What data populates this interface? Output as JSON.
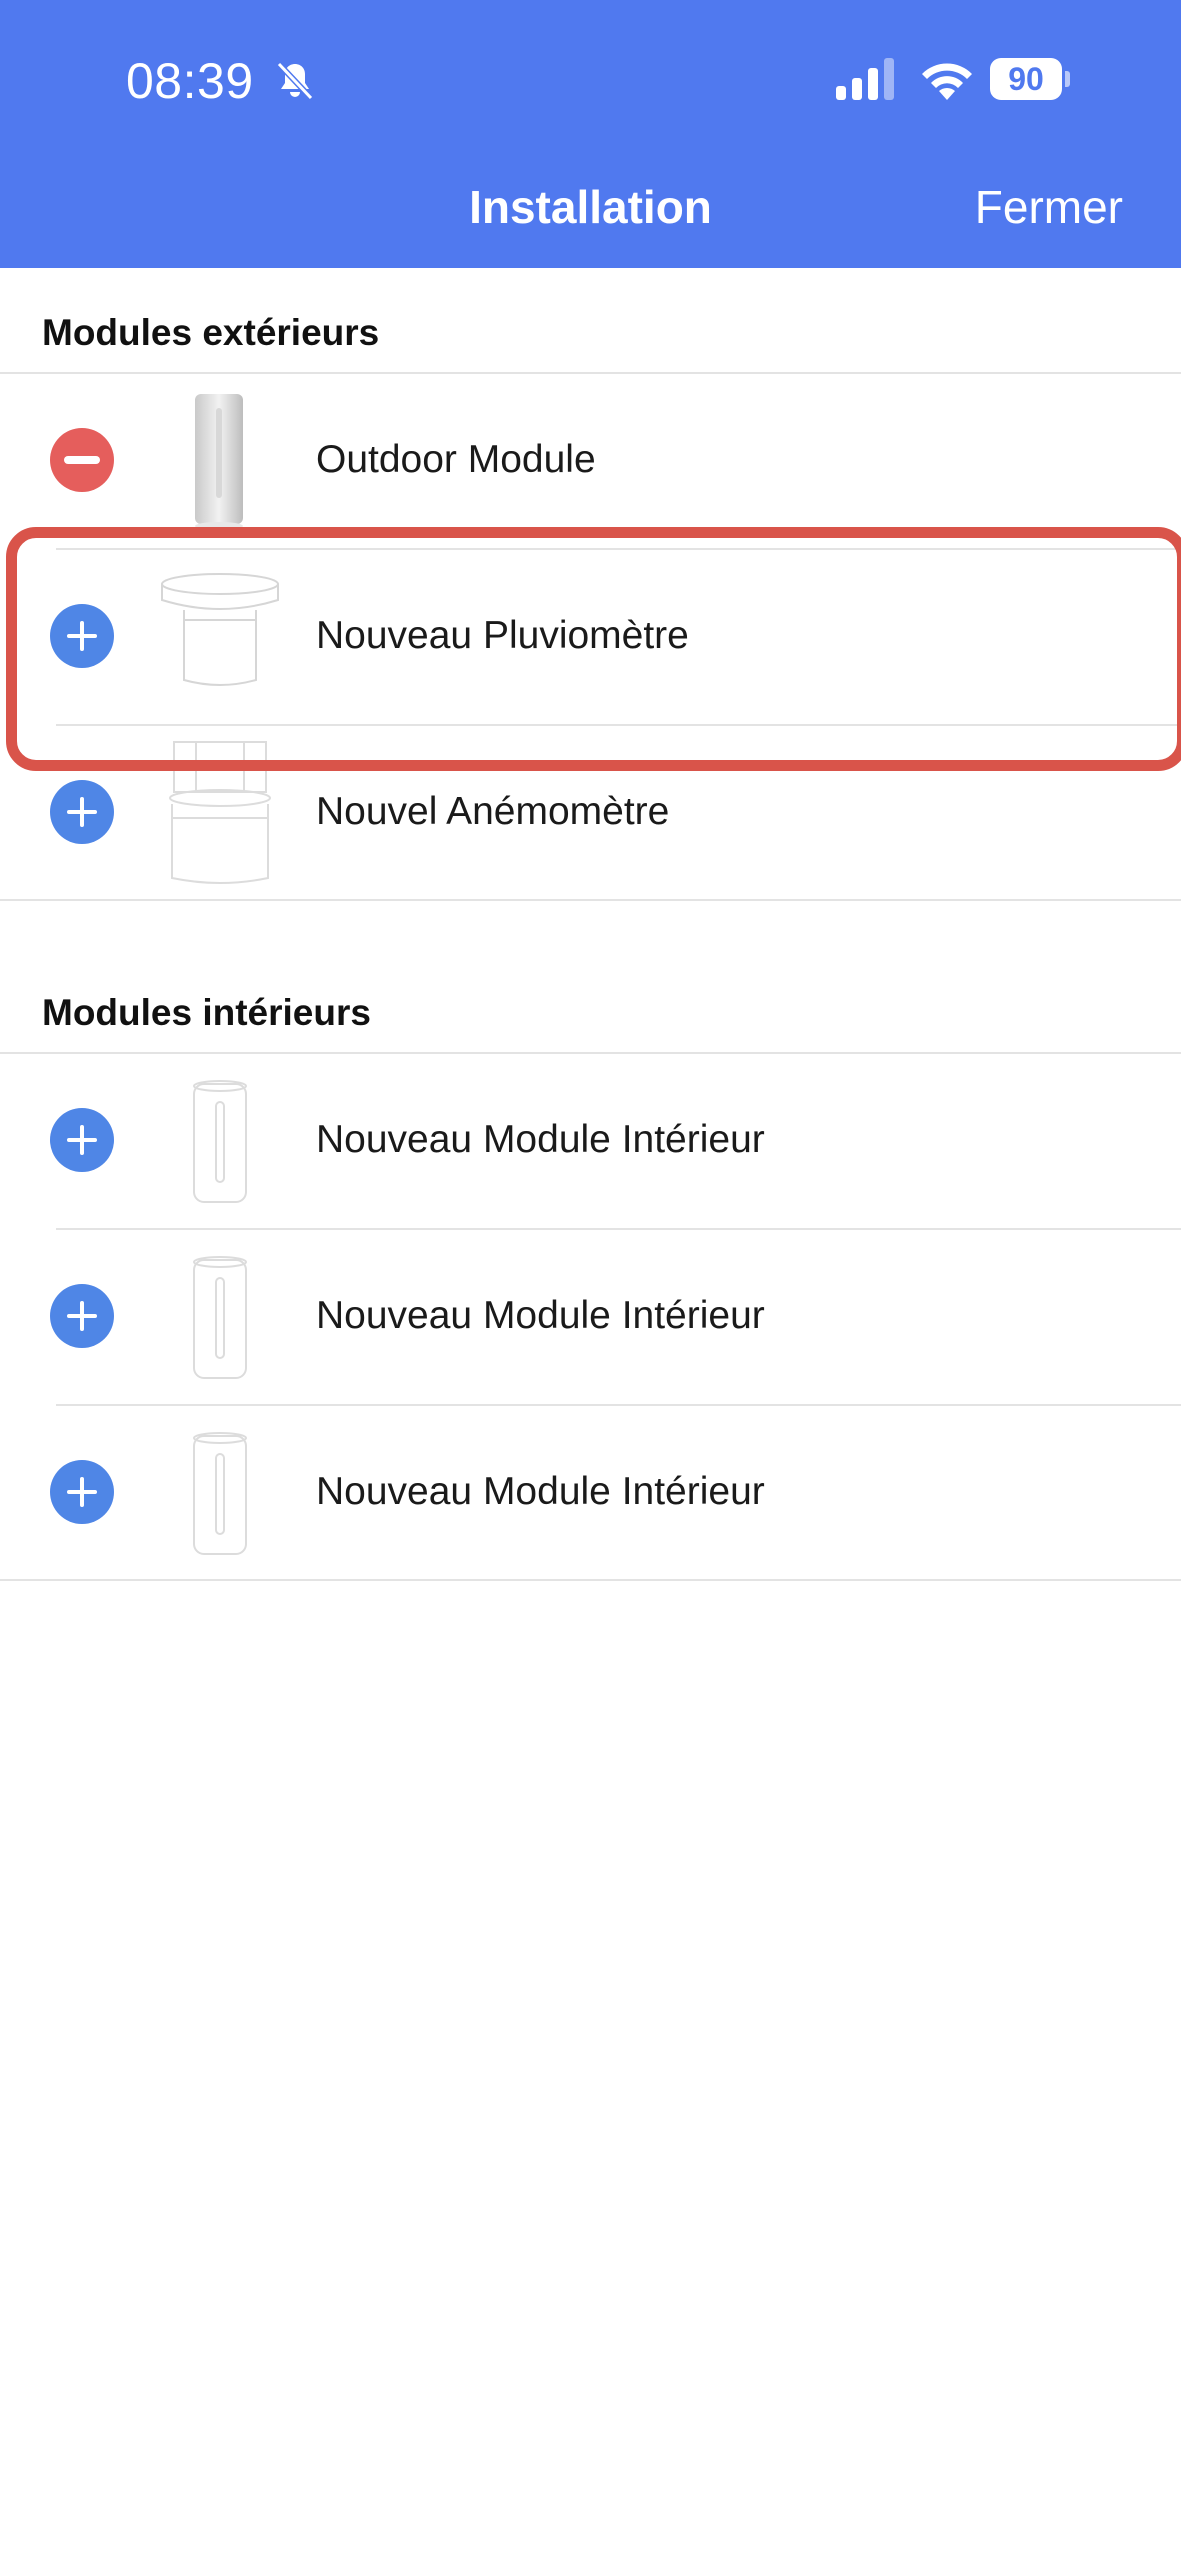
{
  "status_bar": {
    "time": "08:39",
    "battery": "90",
    "icons": [
      "bell-slash-icon",
      "signal-icon",
      "wifi-icon",
      "battery-icon"
    ]
  },
  "header": {
    "title": "Installation",
    "close_label": "Fermer",
    "background": "#5079ef"
  },
  "sections": {
    "outdoor": {
      "title": "Modules extérieurs",
      "items": [
        {
          "label": "Outdoor Module",
          "action": "remove",
          "icon": "outdoor-module-icon"
        },
        {
          "label": "Nouveau Pluviomètre",
          "action": "add",
          "icon": "rain-gauge-icon"
        },
        {
          "label": "Nouvel Anémomètre",
          "action": "add",
          "icon": "anemometer-icon"
        }
      ]
    },
    "indoor": {
      "title": "Modules intérieurs",
      "items": [
        {
          "label": "Nouveau Module Intérieur",
          "action": "add",
          "icon": "indoor-module-icon"
        },
        {
          "label": "Nouveau Module Intérieur",
          "action": "add",
          "icon": "indoor-module-icon"
        },
        {
          "label": "Nouveau Module Intérieur",
          "action": "add",
          "icon": "indoor-module-icon"
        }
      ]
    }
  },
  "colors": {
    "add_button": "#4f86e6",
    "remove_button": "#e55e5c",
    "highlight": "#d9544a"
  }
}
